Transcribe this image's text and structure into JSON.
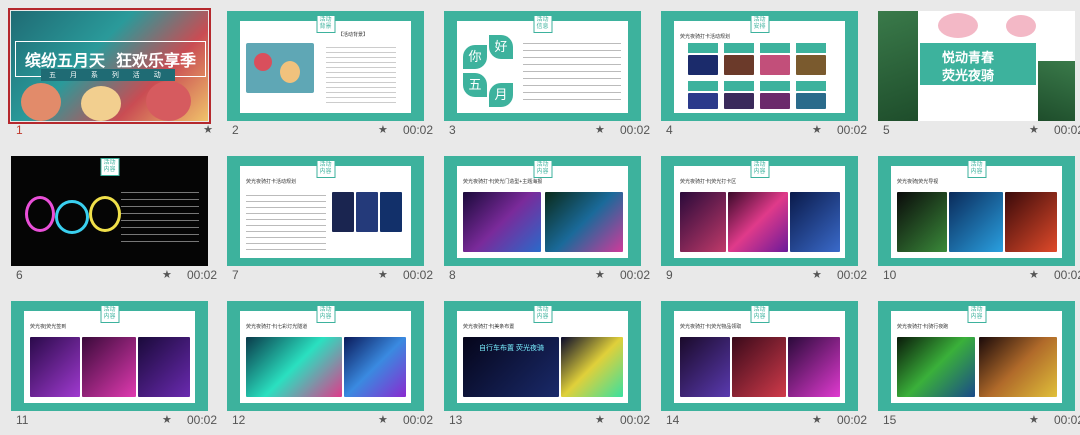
{
  "slides": [
    {
      "num": "1",
      "time": "",
      "selected": true,
      "title_line1": "缤纷五月天",
      "title_line2": "狂欢乐享季",
      "subtitle": "五 月 系 列 活 动"
    },
    {
      "num": "2",
      "time": "00:02",
      "tag": "活动背景",
      "heading": "【活动背景】"
    },
    {
      "num": "3",
      "time": "00:02",
      "tag": "活动信息",
      "hello": [
        "你",
        "好",
        "五",
        "月"
      ]
    },
    {
      "num": "4",
      "time": "00:02",
      "tag": "活动安排",
      "title": "荧光夜骑打卡活动规划"
    },
    {
      "num": "5",
      "time": "00:02",
      "headline1": "悦动青春",
      "headline2": "荧光夜骑"
    },
    {
      "num": "6",
      "time": "00:02",
      "tag": "活动内容"
    },
    {
      "num": "7",
      "time": "00:02",
      "tag": "活动内容",
      "title": "荧光夜骑打卡活动规划"
    },
    {
      "num": "8",
      "time": "00:02",
      "tag": "活动内容",
      "title": "荧光夜骑打卡|荧光门造型+主题海报"
    },
    {
      "num": "9",
      "time": "00:02",
      "tag": "活动内容",
      "title": "荧光夜骑打卡|荧光打卡区"
    },
    {
      "num": "10",
      "time": "00:02",
      "tag": "活动内容",
      "title": "荧光夜骑|荧光导视"
    },
    {
      "num": "11",
      "time": "00:02",
      "tag": "活动内容",
      "title": "荧光夜|荧光签到"
    },
    {
      "num": "12",
      "time": "00:02",
      "tag": "活动内容",
      "title": "荧光夜骑打卡|七彩灯光隧道"
    },
    {
      "num": "13",
      "time": "00:02",
      "tag": "活动内容",
      "title": "荧光夜骑打卡|美条布置",
      "banner": "自行车布置 荧光夜骑"
    },
    {
      "num": "14",
      "time": "00:02",
      "tag": "活动内容",
      "title": "荧光夜骑打卡|荧光物品领取"
    },
    {
      "num": "15",
      "time": "00:02",
      "tag": "活动内容",
      "title": "荧光夜骑打卡|骑行夜跑"
    }
  ],
  "colors": {
    "teal": "#3db29d",
    "selected": "#b5282d"
  }
}
